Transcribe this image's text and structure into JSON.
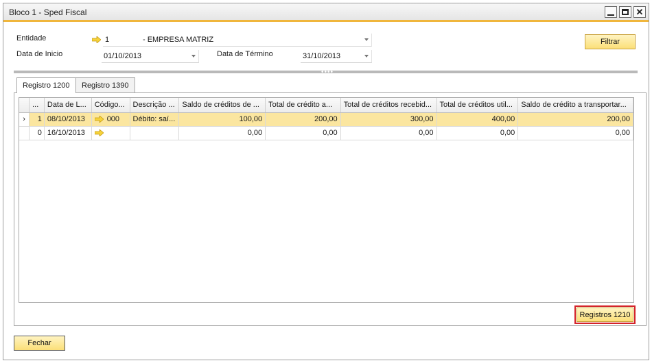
{
  "window": {
    "title": "Bloco 1 - Sped Fiscal"
  },
  "form": {
    "entidade_label": "Entidade",
    "entidade_code": "1",
    "entidade_name": "- EMPRESA MATRIZ",
    "data_inicio_label": "Data de Inicio",
    "data_inicio_value": "01/10/2013",
    "data_termino_label": "Data de Término",
    "data_termino_value": "31/10/2013",
    "filtrar_label": "Filtrar"
  },
  "tabs": [
    {
      "label": "Registro 1200",
      "active": true
    },
    {
      "label": "Registro 1390",
      "active": false
    }
  ],
  "grid": {
    "columns": [
      "...",
      "Data de L...",
      "Código...",
      "Descrição ...",
      "Saldo de créditos de ...",
      "Total de crédito a...",
      "Total de créditos recebid...",
      "Total de créditos util...",
      "Saldo de crédito a transportar..."
    ],
    "rows": [
      {
        "selected": true,
        "idx": "1",
        "data": "08/10/2013",
        "codigo": "000",
        "descricao": "Débito: saí...",
        "saldo": "100,00",
        "total_credito": "200,00",
        "total_recebido": "300,00",
        "total_util": "400,00",
        "saldo_transportar": "200,00"
      },
      {
        "selected": false,
        "idx": "0",
        "data": "16/10/2013",
        "codigo": "",
        "descricao": "",
        "saldo": "0,00",
        "total_credito": "0,00",
        "total_recebido": "0,00",
        "total_util": "0,00",
        "saldo_transportar": "0,00"
      }
    ]
  },
  "buttons": {
    "registros_1210": "Registros 1210",
    "fechar": "Fechar"
  },
  "colors": {
    "accent": "#f0b63c",
    "selected_row": "#fbe6a0",
    "highlight_border": "#d4232a"
  }
}
